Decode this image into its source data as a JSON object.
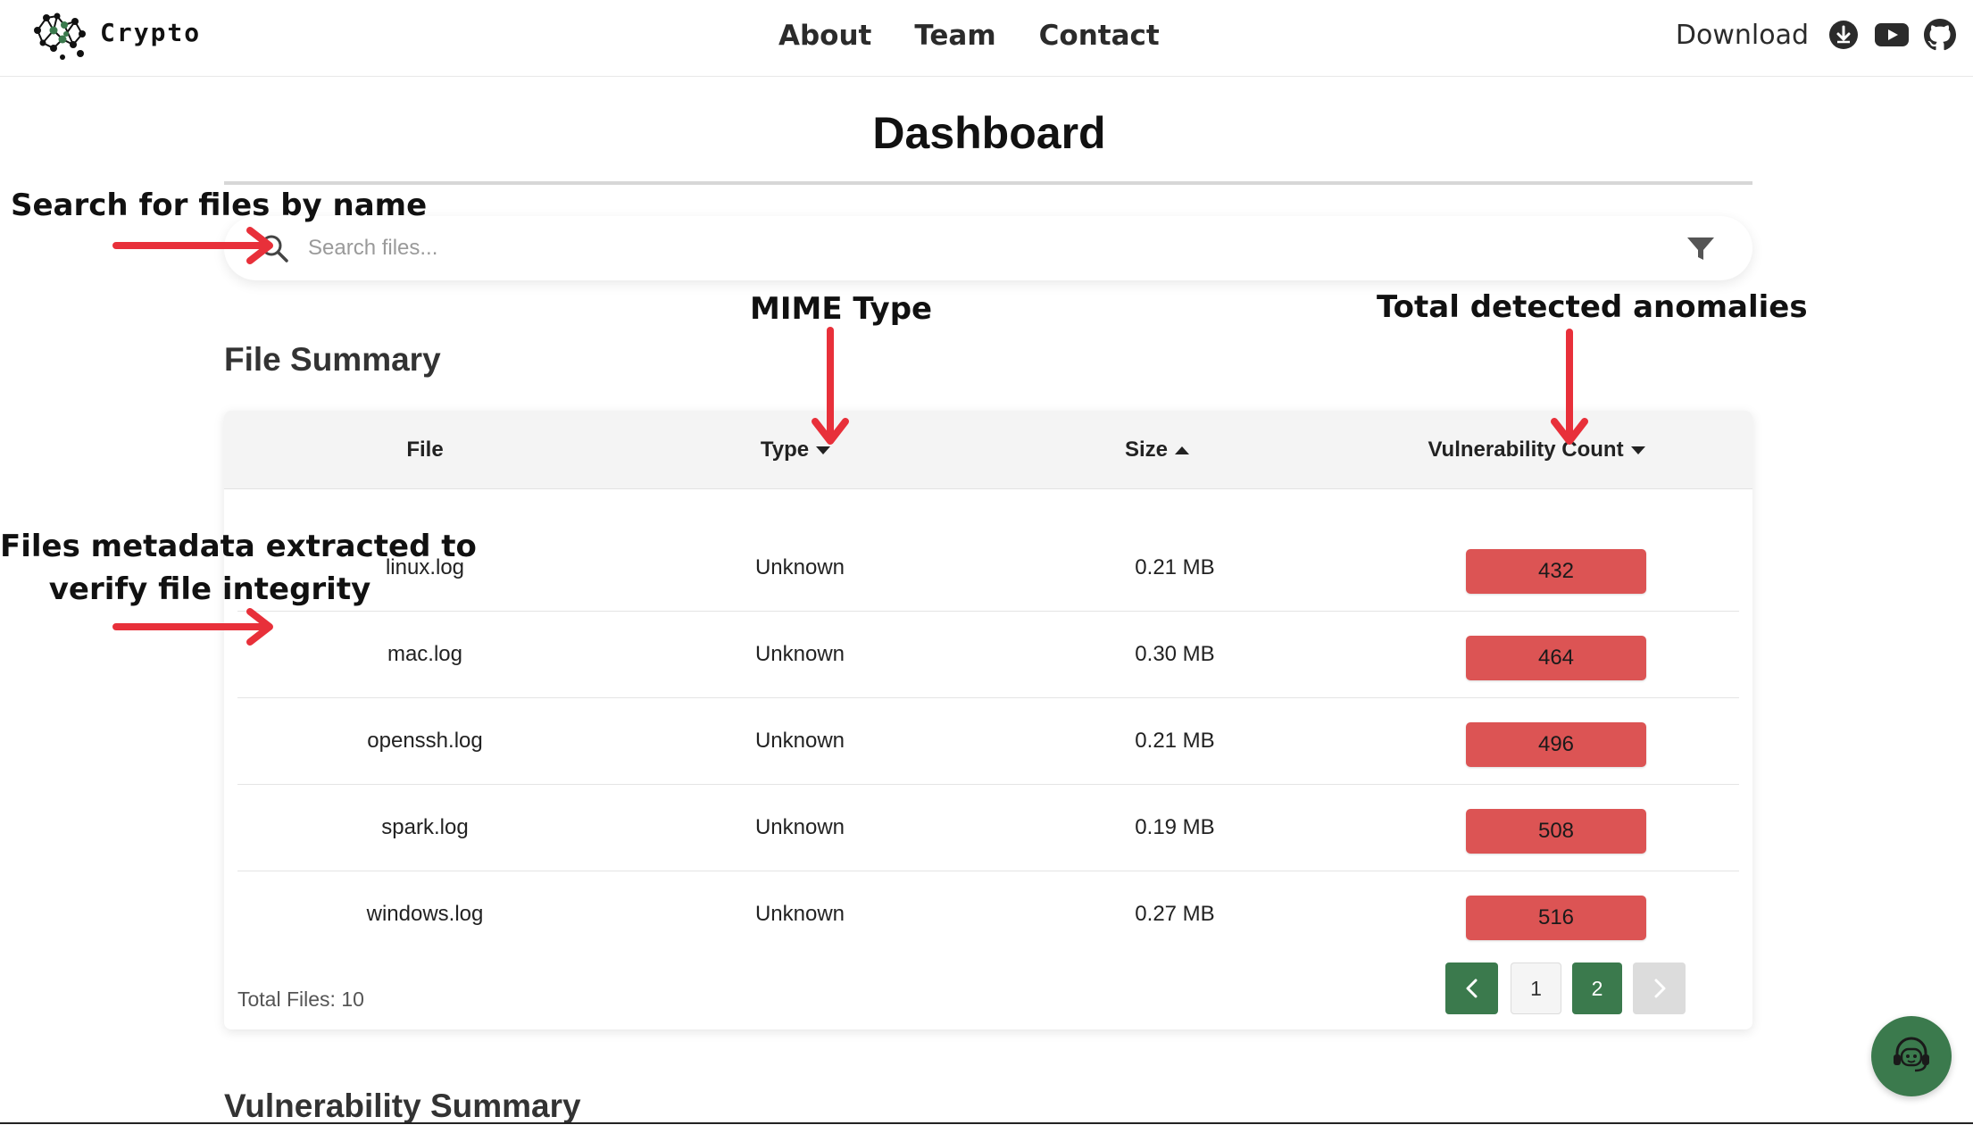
{
  "app": {
    "brand": "Crypto"
  },
  "nav": {
    "links": [
      "About",
      "Team",
      "Contact"
    ],
    "download_label": "Download",
    "icons": [
      "download-icon",
      "youtube-icon",
      "github-icon"
    ]
  },
  "page": {
    "title": "Dashboard"
  },
  "search": {
    "placeholder": "Search files...",
    "value": ""
  },
  "file_summary": {
    "title": "File Summary",
    "columns": [
      "File",
      "Type",
      "Size",
      "Vulnerability Count"
    ],
    "sort": {
      "Type": "desc",
      "Size": "asc",
      "Vulnerability Count": "desc"
    },
    "rows": [
      {
        "file": "linux.log",
        "type": "Unknown",
        "size": "0.21 MB",
        "vuln": "432"
      },
      {
        "file": "mac.log",
        "type": "Unknown",
        "size": "0.30 MB",
        "vuln": "464"
      },
      {
        "file": "openssh.log",
        "type": "Unknown",
        "size": "0.21 MB",
        "vuln": "496"
      },
      {
        "file": "spark.log",
        "type": "Unknown",
        "size": "0.19 MB",
        "vuln": "508"
      },
      {
        "file": "windows.log",
        "type": "Unknown",
        "size": "0.27 MB",
        "vuln": "516"
      }
    ],
    "total_files": "Total Files: 10",
    "pagination": {
      "pages": [
        "1",
        "2"
      ],
      "current": "2"
    }
  },
  "vulnerability_summary": {
    "title": "Vulnerability Summary"
  },
  "annotations": {
    "search": "Search for files by name",
    "mime": "MIME Type",
    "anomalies": "Total detected anomalies",
    "metadata_line1": "Files metadata extracted to",
    "metadata_line2": "verify file integrity"
  },
  "colors": {
    "accent": "#3b7a4d",
    "badge": "#dc5454",
    "annotation_arrow": "#e8303a"
  }
}
